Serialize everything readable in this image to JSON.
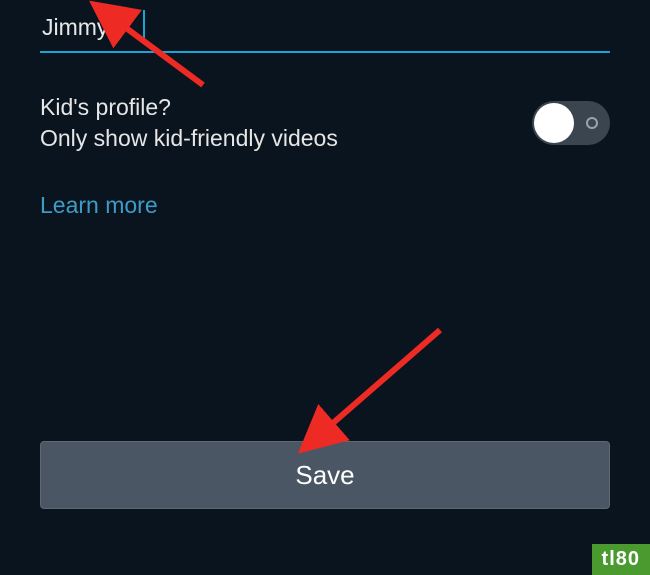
{
  "profile": {
    "name_value": "Jimmy"
  },
  "kids": {
    "line1": "Kid's profile?",
    "line2": "Only show kid-friendly videos",
    "toggle_on": false
  },
  "links": {
    "learn_more": "Learn more"
  },
  "buttons": {
    "save": "Save"
  },
  "watermark": {
    "text": "tl80"
  },
  "colors": {
    "background": "#0a141e",
    "accent": "#1ca3d4",
    "link": "#3d9cc6",
    "button_bg": "#4a5663",
    "arrow": "#ee2a24",
    "watermark_bg": "#4a9a2f"
  }
}
